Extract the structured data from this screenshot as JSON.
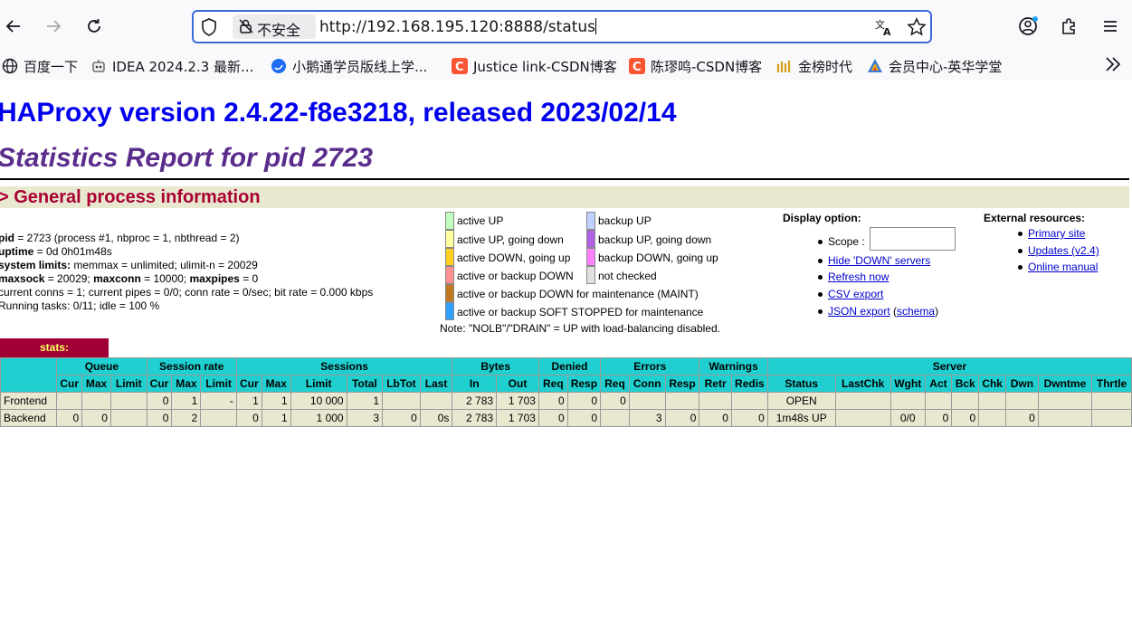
{
  "browser": {
    "insecure_label": "不安全",
    "url": "http://192.168.195.120:8888/status"
  },
  "bookmarks": [
    {
      "label": "百度一下",
      "icon": "globe-icon"
    },
    {
      "label": "IDEA 2024.2.3 最新...",
      "icon": "robot-icon"
    },
    {
      "label": "小鹅通学员版线上学...",
      "icon": "blue-bird-icon"
    },
    {
      "label": "Justice link-CSDN博客",
      "icon": "csdn-icon"
    },
    {
      "label": "陈璆鸣-CSDN博客",
      "icon": "csdn-icon"
    },
    {
      "label": "金榜时代",
      "icon": "jinbang-icon"
    },
    {
      "label": "会员中心-英华学堂",
      "icon": "yinghua-icon"
    }
  ],
  "colors": {
    "link": "#0000cc",
    "version": "#0000ee",
    "report": "#5a2d8c",
    "section": "#aa0033",
    "header_bg": "#20d0d0",
    "row_bg": "#e8e8d0"
  },
  "page": {
    "version_title": "HAProxy version 2.4.22-f8e3218, released 2023/02/14",
    "report_title": "Statistics Report for pid 2723",
    "section_title": "> General process information",
    "info": {
      "pid_label": "pid",
      "pid_value": " = 2723 (process #1, nbproc = 1, nbthread = 2)",
      "uptime_label": "uptime",
      "uptime_value": " = 0d 0h01m48s",
      "limits_label": "system limits:",
      "limits_value": " memmax = unlimited; ulimit-n = 20029",
      "maxsock_label": "maxsock",
      "maxsock_value": " = 20029; ",
      "maxconn_label": "maxconn",
      "maxconn_value": " = 10000; ",
      "maxpipes_label": "maxpipes",
      "maxpipes_value": " = 0",
      "conns_line": "current conns = 1; current pipes = 0/0; conn rate = 0/sec; bit rate = 0.000 kbps",
      "tasks_line": "Running tasks: 0/11; idle = 100 %"
    },
    "legend_left": [
      {
        "label": "active UP",
        "color": "#c0ffc0"
      },
      {
        "label": "active UP, going down",
        "color": "#ffffa0"
      },
      {
        "label": "active DOWN, going up",
        "color": "#ffd020"
      },
      {
        "label": "active or backup DOWN",
        "color": "#ff9090"
      },
      {
        "label": "active or backup DOWN for maintenance (MAINT)",
        "color": "#c07820"
      },
      {
        "label": "active or backup SOFT STOPPED for maintenance",
        "color": "#30a0ff"
      }
    ],
    "legend_right": [
      {
        "label": "backup UP",
        "color": "#c0d0ff"
      },
      {
        "label": "backup UP, going down",
        "color": "#b060e0"
      },
      {
        "label": "backup DOWN, going up",
        "color": "#ff80ff"
      },
      {
        "label": "not checked",
        "color": "#e0e0e0"
      }
    ],
    "note": "Note: \"NOLB\"/\"DRAIN\" = UP with load-balancing disabled.",
    "display_option": {
      "title": "Display option:",
      "scope_label": "Scope :",
      "hide_down": "Hide 'DOWN' servers",
      "refresh": "Refresh now",
      "csv": "CSV export",
      "json": "JSON export",
      "schema_open": " (",
      "schema": "schema",
      "schema_close": ")"
    },
    "external": {
      "title": "External resources:",
      "primary": "Primary site",
      "updates": "Updates (v2.4)",
      "manual": "Online manual"
    }
  },
  "stats": {
    "tab_label": "stats:",
    "groups": [
      "Queue",
      "Session rate",
      "Sessions",
      "Bytes",
      "Denied",
      "Errors",
      "Warnings",
      "Server"
    ],
    "columns": [
      "Cur",
      "Max",
      "Limit",
      "Cur",
      "Max",
      "Limit",
      "Cur",
      "Max",
      "Limit",
      "Total",
      "LbTot",
      "Last",
      "In",
      "Out",
      "Req",
      "Resp",
      "Req",
      "Conn",
      "Resp",
      "Retr",
      "Redis",
      "Status",
      "LastChk",
      "Wght",
      "Act",
      "Bck",
      "Chk",
      "Dwn",
      "Dwntme",
      "Thrtle"
    ],
    "rows": [
      {
        "name": "Frontend",
        "cells": [
          "",
          "",
          "",
          "0",
          "1",
          "-",
          "1",
          "1",
          "10 000",
          "1",
          "",
          "",
          "2 783",
          "1 703",
          "0",
          "0",
          "0",
          "",
          "",
          "",
          "",
          "OPEN",
          "",
          "",
          "",
          "",
          "",
          "",
          "",
          ""
        ]
      },
      {
        "name": "Backend",
        "cells": [
          "0",
          "0",
          "",
          "0",
          "2",
          "",
          "0",
          "1",
          "1 000",
          "3",
          "0",
          "0s",
          "2 783",
          "1 703",
          "0",
          "0",
          "",
          "3",
          "0",
          "0",
          "0",
          "1m48s UP",
          "",
          "0/0",
          "0",
          "0",
          "",
          "0",
          "",
          ""
        ]
      }
    ]
  }
}
